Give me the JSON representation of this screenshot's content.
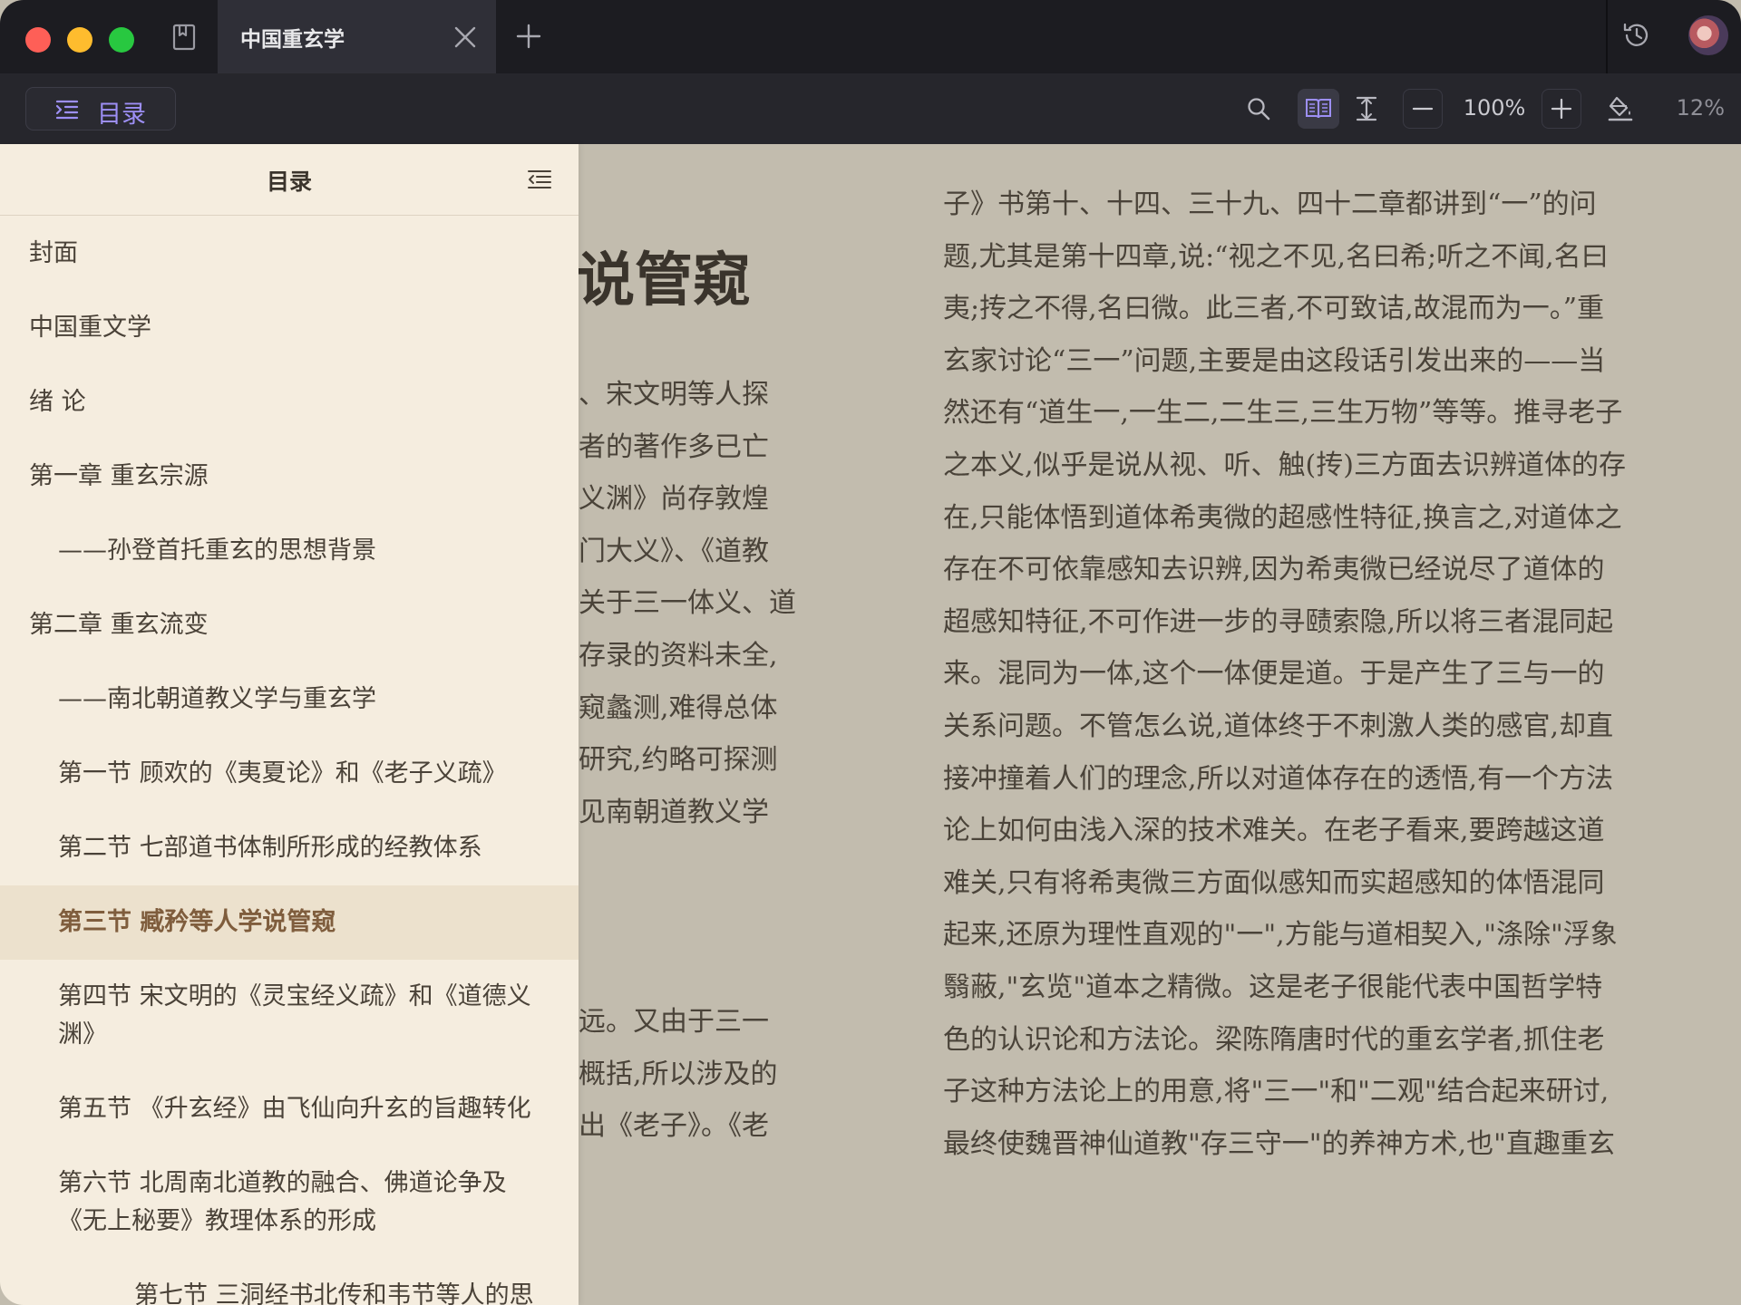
{
  "tab": {
    "title": "中国重玄学"
  },
  "toolbar": {
    "toc_label": "目录",
    "zoom": "100%",
    "progress": "12%"
  },
  "sidebar": {
    "title": "目录",
    "items": [
      {
        "label": "封面"
      },
      {
        "label": "中国重文学"
      },
      {
        "label": "绪 论"
      },
      {
        "label": "第一章 重玄宗源"
      },
      {
        "label": "——孙登首托重玄的思想背景"
      },
      {
        "label": "第二章 重玄流变"
      },
      {
        "label": "——南北朝道教义学与重玄学"
      },
      {
        "label": "第一节 顾欢的《夷夏论》和《老子义疏》"
      },
      {
        "label": "第二节 七部道书体制所形成的经教体系"
      },
      {
        "label": "第三节 臧矜等人学说管窥"
      },
      {
        "label": "第四节 宋文明的《灵宝经义疏》和《道德义渊》"
      },
      {
        "label": "第五节 《升玄经》由飞仙向升玄的旨趣转化"
      },
      {
        "label": "第六节 北周南北道教的融合、佛道论争及《无上秘要》教理体系的形成"
      },
      {
        "label": "第七节 三洞经书北传和韦节等人的思想学术"
      }
    ]
  },
  "page": {
    "left_title": "说管窥",
    "left_lines_top": [
      "、宋文明等人探",
      "者的著作多已亡",
      "义渊》尚存敦煌",
      "门大义》、《道教",
      "关于三一体义、道",
      "存录的资料未全,",
      "窥蠡测,难得总体",
      "研究,约略可探测",
      "见南朝道教义学"
    ],
    "left_lines_bottom": [
      "远。又由于三一",
      "概括,所以涉及的",
      "出《老子》。《老"
    ],
    "right_lines": [
      "子》书第十、十四、三十九、四十二章都讲到“一”的问",
      "题,尤其是第十四章,说:“视之不见,名曰希;听之不闻,名曰",
      "夷;抟之不得,名曰微。此三者,不可致诘,故混而为一。”重",
      "玄家讨论“三一”问题,主要是由这段话引发出来的——当",
      "然还有“道生一,一生二,二生三,三生万物”等等。推寻老子",
      "之本义,似乎是说从视、听、触(抟)三方面去识辨道体的存",
      "在,只能体悟到道体希夷微的超感性特征,换言之,对道体之",
      "存在不可依靠感知去识辨,因为希夷微已经说尽了道体的",
      "超感知特征,不可作进一步的寻赜索隐,所以将三者混同起",
      "来。混同为一体,这个一体便是道。于是产生了三与一的",
      "关系问题。不管怎么说,道体终于不刺激人类的感官,却直",
      "接冲撞着人们的理念,所以对道体存在的透悟,有一个方法",
      "论上如何由浅入深的技术难关。在老子看来,要跨越这道",
      "难关,只有将希夷微三方面似感知而实超感知的体悟混同",
      "起来,还原为理性直观的\"一\",方能与道相契入,\"涤除\"浮象",
      "翳蔽,\"玄览\"道本之精微。这是老子很能代表中国哲学特",
      "色的认识论和方法论。梁陈隋唐时代的重玄学者,抓住老",
      "子这种方法论上的用意,将\"三一\"和\"二观\"结合起来研讨,",
      "最终使魏晋神仙道教\"存三守一\"的养神方术,也\"直趣重玄"
    ]
  }
}
